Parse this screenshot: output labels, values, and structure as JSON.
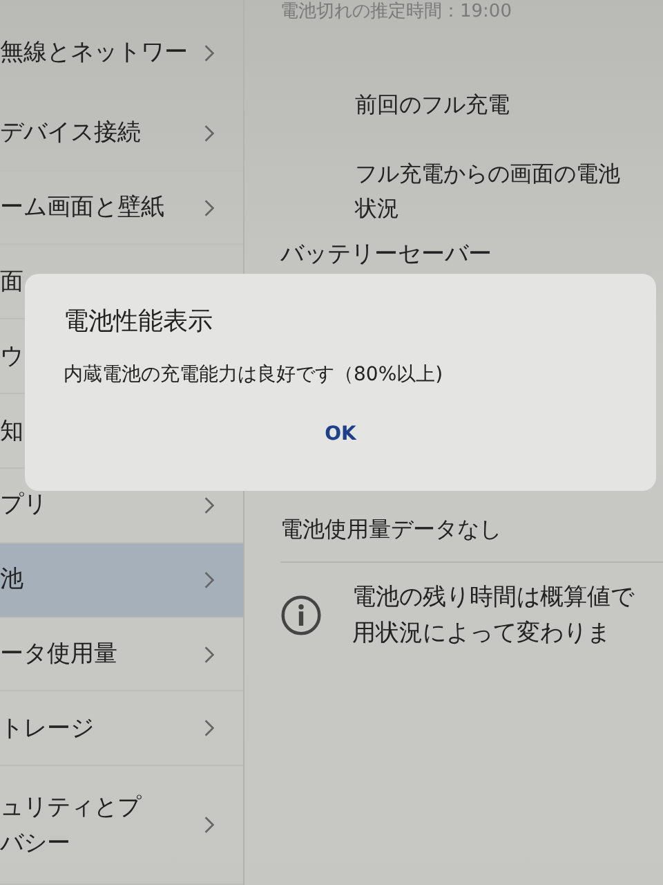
{
  "sidebar": {
    "items": [
      {
        "lines": [
          "無線とネットワー"
        ],
        "selected": false
      },
      {
        "lines": [
          "デバイス接続"
        ],
        "selected": false
      },
      {
        "lines": [
          "ーム画面と壁紙"
        ],
        "selected": false
      },
      {
        "lines": [
          "面"
        ],
        "selected": false,
        "chevron": false
      },
      {
        "lines": [
          "ウ"
        ],
        "selected": false,
        "chevron": false
      },
      {
        "lines": [
          "知"
        ],
        "selected": false,
        "chevron": false
      },
      {
        "lines": [
          "プリ"
        ],
        "selected": false
      },
      {
        "lines": [
          "池"
        ],
        "selected": true
      },
      {
        "lines": [
          "ータ使用量"
        ],
        "selected": false
      },
      {
        "lines": [
          "トレージ"
        ],
        "selected": false
      },
      {
        "lines": [
          "ュリティとプ",
          "バシー"
        ],
        "selected": false
      }
    ]
  },
  "content": {
    "estimate": "電池切れの推定時間：19:00",
    "last_full_charge": "前回のフル充電",
    "screen_usage": [
      "フル充電からの画面の電池",
      "状況"
    ],
    "battery_saver": "バッテリーセーバー",
    "no_data": "電池使用量データなし",
    "note": [
      "電池の残り時間は概算値で",
      "用状況によって変わりま"
    ]
  },
  "dialog": {
    "title": "電池性能表示",
    "message": "内蔵電池の充電能力は良好です（80%以上)",
    "button": "OK"
  }
}
